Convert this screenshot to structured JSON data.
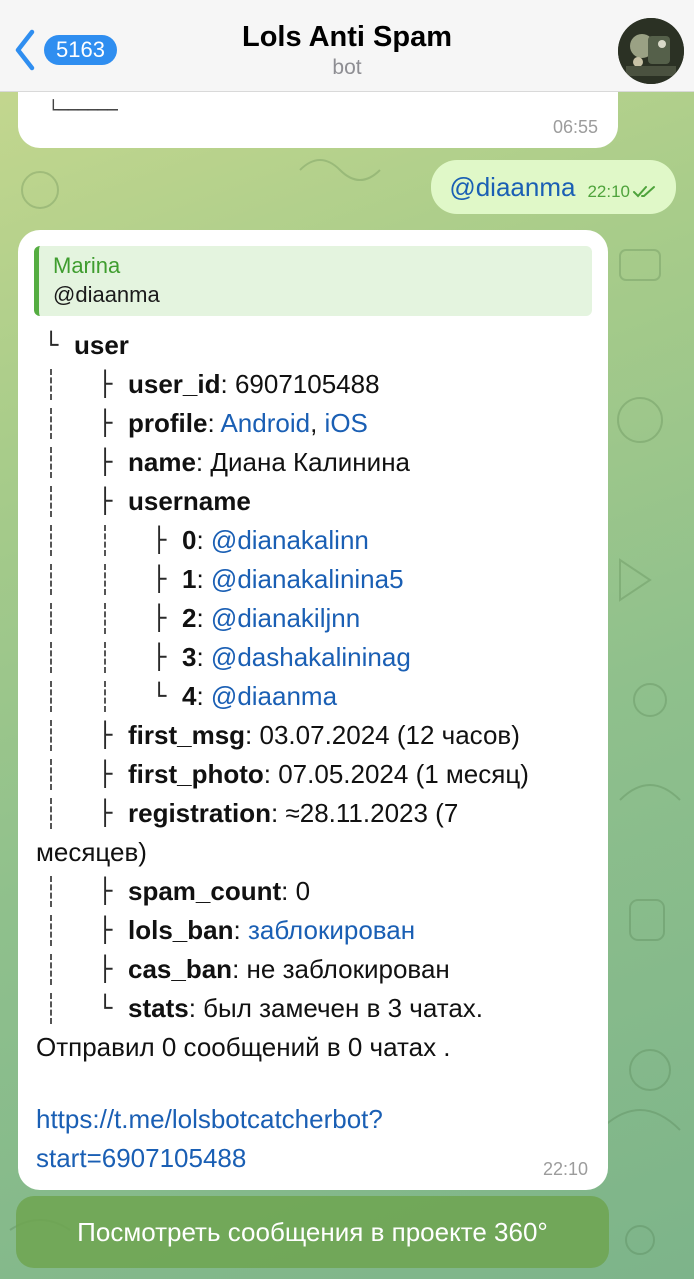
{
  "header": {
    "back_count": "5163",
    "title": "Lols Anti Spam",
    "subtitle": "bot"
  },
  "messages": {
    "prev": {
      "tree_end": "└──────",
      "time": "06:55"
    },
    "outgoing": {
      "text": "@diaanma",
      "time": "22:10"
    },
    "bot": {
      "quote_name": "Marina",
      "quote_text": "@diaanma",
      "root": "user",
      "user_id_key": "user_id",
      "user_id_val": "6907105488",
      "profile_key": "profile",
      "profile_val1": "Android",
      "profile_val2": "iOS",
      "name_key": "name",
      "name_val": "Диана Калинина",
      "username_key": "username",
      "usernames": [
        {
          "idx": "0",
          "val": "@dianakalinn"
        },
        {
          "idx": "1",
          "val": "@dianakalinina5"
        },
        {
          "idx": "2",
          "val": "@dianakiljnn"
        },
        {
          "idx": "3",
          "val": "@dashakalininag"
        },
        {
          "idx": "4",
          "val": "@diaanma"
        }
      ],
      "first_msg_key": "first_msg",
      "first_msg_val": "03.07.2024 (12 часов)",
      "first_photo_key": "first_photo",
      "first_photo_val": "07.05.2024 (1 месяц)",
      "registration_key": "registration",
      "registration_val": "≈28.11.2023 (7",
      "registration_cont": "месяцев)",
      "spam_count_key": "spam_count",
      "spam_count_val": "0",
      "lols_ban_key": "lols_ban",
      "lols_ban_val": "заблокирован",
      "cas_ban_key": "cas_ban",
      "cas_ban_val": "не заблокирован",
      "stats_key": "stats",
      "stats_val": "был замечен в 3 чатах.",
      "stats_cont": "Отправил 0 сообщений в 0 чатах .",
      "link_line1": "https://t.me/lolsbotcatcherbot?",
      "link_line2": "start=6907105488",
      "time": "22:10"
    }
  },
  "action_button": "Посмотреть сообщения в проекте 360°",
  "icons": {
    "back": "chevron-left-icon",
    "read": "double-check-icon",
    "avatar": "bot-avatar"
  },
  "colors": {
    "accent": "#2f8ef0",
    "link": "#1a5fb4",
    "quote": "#55ad41",
    "outgoing_bubble": "#e0f8c8"
  }
}
